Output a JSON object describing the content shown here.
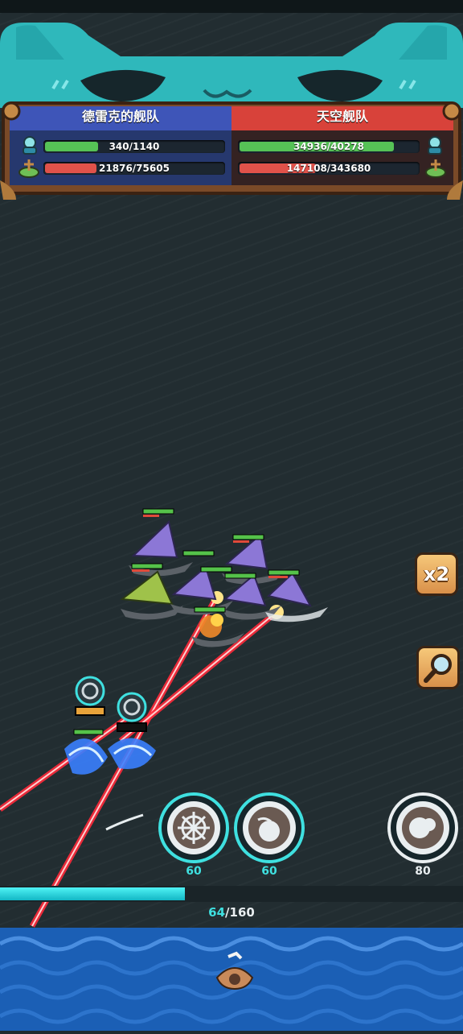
{
  "teams": {
    "left": {
      "name": "德雷克的舰队",
      "hp_text": "340/1140",
      "hp_fraction": 0.298,
      "power_text": "21876/75605",
      "power_fraction": 0.289
    },
    "right": {
      "name": "天空舰队",
      "hp_text": "34936/40278",
      "hp_fraction": 0.867,
      "power_text": "147108/343680",
      "power_fraction": 0.428
    }
  },
  "side_buttons": {
    "speed_label": "x2"
  },
  "skills": [
    {
      "name": "wheel-skill",
      "cost": "60"
    },
    {
      "name": "cannonball-skill",
      "cost": "60"
    },
    {
      "name": "smoke-bomb-skill",
      "cost": "80"
    }
  ],
  "progress": {
    "current": "64",
    "total": "/160",
    "fraction": 0.4
  },
  "colors": {
    "left_team": "#3e55b8",
    "right_team": "#d8423a",
    "hp_bar": "#56c256",
    "power_bar": "#e0524a",
    "accent_cyan": "#3fe0e0",
    "laser": "#ff2a3a"
  }
}
